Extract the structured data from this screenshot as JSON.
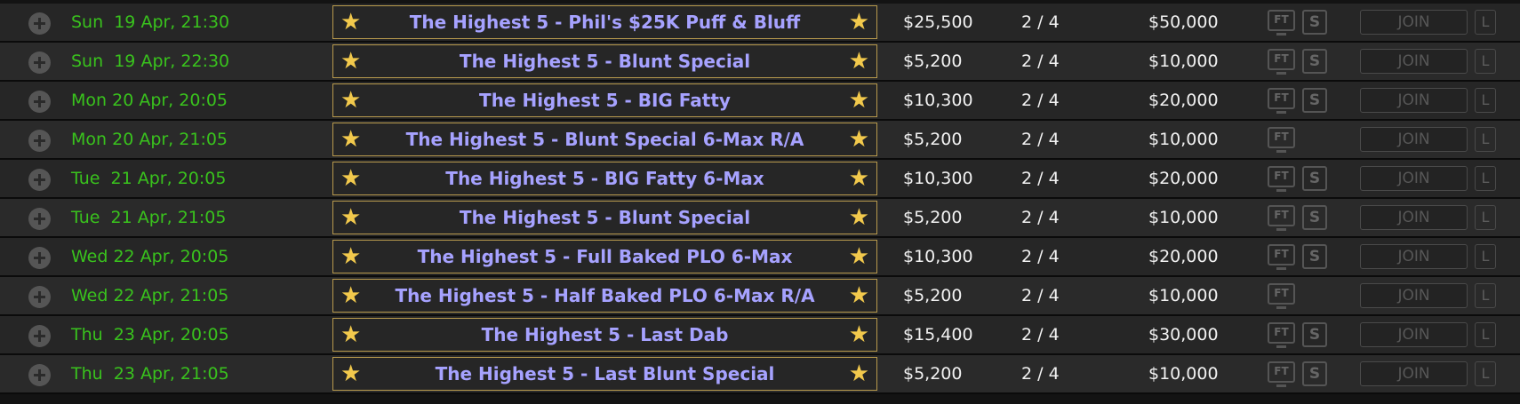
{
  "colors": {
    "date": "#39c21d",
    "name": "#a6a2ff",
    "star": "#f2c94c",
    "text": "#f2f2f2"
  },
  "icons": {
    "expand": "plus-circle-icon",
    "favorite": "star-icon",
    "ft": "ft-monitor-icon",
    "s": "s-badge-icon",
    "l": "l-badge-icon"
  },
  "tournaments": [
    {
      "date": "Sun  19 Apr, 21:30",
      "name": "The Highest 5 - Phil's $25K Puff & Bluff",
      "buyin": "$25,500",
      "players": "2 / 4",
      "guarantee": "$50,000",
      "ft": "FT",
      "s": "S",
      "join": "JOIN",
      "l": "L"
    },
    {
      "date": "Sun  19 Apr, 22:30",
      "name": "The Highest 5 - Blunt Special",
      "buyin": "$5,200",
      "players": "2 / 4",
      "guarantee": "$10,000",
      "ft": "FT",
      "s": "S",
      "join": "JOIN",
      "l": "L"
    },
    {
      "date": "Mon 20 Apr, 20:05",
      "name": "The Highest 5 - BIG Fatty",
      "buyin": "$10,300",
      "players": "2 / 4",
      "guarantee": "$20,000",
      "ft": "FT",
      "s": "S",
      "join": "JOIN",
      "l": "L"
    },
    {
      "date": "Mon 20 Apr, 21:05",
      "name": "The Highest 5 - Blunt Special 6-Max R/A",
      "buyin": "$5,200",
      "players": "2 / 4",
      "guarantee": "$10,000",
      "ft": "FT",
      "s": "",
      "join": "JOIN",
      "l": "L"
    },
    {
      "date": "Tue  21 Apr, 20:05",
      "name": "The Highest 5 - BIG Fatty 6-Max",
      "buyin": "$10,300",
      "players": "2 / 4",
      "guarantee": "$20,000",
      "ft": "FT",
      "s": "S",
      "join": "JOIN",
      "l": "L"
    },
    {
      "date": "Tue  21 Apr, 21:05",
      "name": "The Highest 5 - Blunt Special",
      "buyin": "$5,200",
      "players": "2 / 4",
      "guarantee": "$10,000",
      "ft": "FT",
      "s": "S",
      "join": "JOIN",
      "l": "L"
    },
    {
      "date": "Wed 22 Apr, 20:05",
      "name": "The Highest 5 - Full Baked PLO 6-Max",
      "buyin": "$10,300",
      "players": "2 / 4",
      "guarantee": "$20,000",
      "ft": "FT",
      "s": "S",
      "join": "JOIN",
      "l": "L"
    },
    {
      "date": "Wed 22 Apr, 21:05",
      "name": "The Highest 5 - Half Baked PLO 6-Max R/A",
      "buyin": "$5,200",
      "players": "2 / 4",
      "guarantee": "$10,000",
      "ft": "FT",
      "s": "",
      "join": "JOIN",
      "l": "L"
    },
    {
      "date": "Thu  23 Apr, 20:05",
      "name": "The Highest 5 - Last Dab",
      "buyin": "$15,400",
      "players": "2 / 4",
      "guarantee": "$30,000",
      "ft": "FT",
      "s": "S",
      "join": "JOIN",
      "l": "L"
    },
    {
      "date": "Thu  23 Apr, 21:05",
      "name": "The Highest 5 - Last Blunt Special",
      "buyin": "$5,200",
      "players": "2 / 4",
      "guarantee": "$10,000",
      "ft": "FT",
      "s": "S",
      "join": "JOIN",
      "l": "L"
    }
  ]
}
